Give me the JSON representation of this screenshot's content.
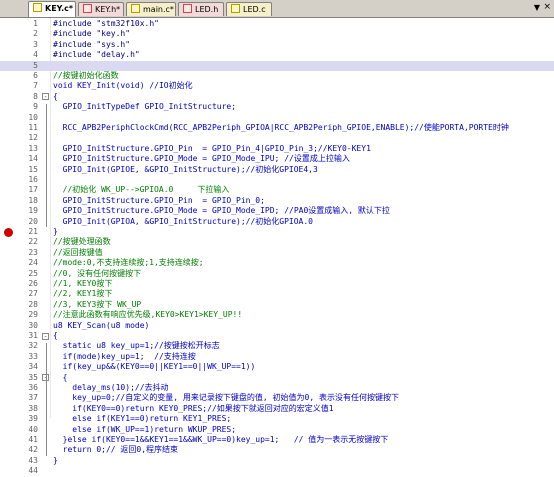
{
  "tabs": [
    {
      "label": "KEY.c*",
      "type": "c",
      "active": true
    },
    {
      "label": "KEY.h*",
      "type": "h",
      "active": false
    },
    {
      "label": "main.c*",
      "type": "c",
      "active": false
    },
    {
      "label": "LED.h",
      "type": "h",
      "active": false
    },
    {
      "label": "LED.c",
      "type": "c",
      "active": false
    }
  ],
  "tabbar": {
    "dropdown_glyph": "▼",
    "close_glyph": "×"
  },
  "editor": {
    "highlight_line": 5,
    "breakpoint_line": 21,
    "lines": [
      {
        "n": "1",
        "text": "#include \"stm32f10x.h\"",
        "style": "pp"
      },
      {
        "n": "2",
        "text": "#include \"key.h\"",
        "style": "pp"
      },
      {
        "n": "3",
        "text": "#include \"sys.h\"",
        "style": "pp"
      },
      {
        "n": "4",
        "text": "#include \"delay.h\"",
        "style": "pp"
      },
      {
        "n": "5",
        "text": "",
        "style": "code"
      },
      {
        "n": "6",
        "text": "//按键初始化函数",
        "style": "cm"
      },
      {
        "n": "7",
        "text": "void KEY_Init(void) //IO初始化",
        "style": "code"
      },
      {
        "n": "8",
        "text": "{",
        "style": "code",
        "fold": "-"
      },
      {
        "n": "9",
        "text": "  GPIO_InitTypeDef GPIO_InitStructure;",
        "style": "code"
      },
      {
        "n": "10",
        "text": "",
        "style": "code"
      },
      {
        "n": "11",
        "text": "  RCC_APB2PeriphClockCmd(RCC_APB2Periph_GPIOA|RCC_APB2Periph_GPIOE,ENABLE);//使能PORTA,PORTE时钟",
        "style": "code"
      },
      {
        "n": "12",
        "text": "",
        "style": "code"
      },
      {
        "n": "13",
        "text": "  GPIO_InitStructure.GPIO_Pin  = GPIO_Pin_4|GPIO_Pin_3;//KEY0-KEY1",
        "style": "code"
      },
      {
        "n": "14",
        "text": "  GPIO_InitStructure.GPIO_Mode = GPIO_Mode_IPU; //设置成上拉输入",
        "style": "code"
      },
      {
        "n": "15",
        "text": "  GPIO_Init(GPIOE, &GPIO_InitStructure);//初始化GPIOE4,3",
        "style": "code"
      },
      {
        "n": "16",
        "text": "",
        "style": "code"
      },
      {
        "n": "17",
        "text": "  //初始化 WK_UP-->GPIOA.0     下拉输入",
        "style": "cm"
      },
      {
        "n": "18",
        "text": "  GPIO_InitStructure.GPIO_Pin  = GPIO_Pin_0;",
        "style": "code"
      },
      {
        "n": "19",
        "text": "  GPIO_InitStructure.GPIO_Mode = GPIO_Mode_IPD; //PA0设置成输入, 默认下拉",
        "style": "code"
      },
      {
        "n": "20",
        "text": "  GPIO_Init(GPIOA, &GPIO_InitStructure);//初始化GPIOA.0",
        "style": "code"
      },
      {
        "n": "21",
        "text": "}",
        "style": "code"
      },
      {
        "n": "22",
        "text": "//按键处理函数",
        "style": "cm"
      },
      {
        "n": "23",
        "text": "//返回按键值",
        "style": "cm"
      },
      {
        "n": "24",
        "text": "//mode:0,不支持连续按;1,支持连续按;",
        "style": "cm"
      },
      {
        "n": "25",
        "text": "//0, 没有任何按键按下",
        "style": "cm"
      },
      {
        "n": "26",
        "text": "//1, KEY0按下",
        "style": "cm"
      },
      {
        "n": "27",
        "text": "//2, KEY1按下",
        "style": "cm"
      },
      {
        "n": "28",
        "text": "//3, KEY3按下 WK_UP",
        "style": "cm"
      },
      {
        "n": "29",
        "text": "//注意此函数有响应优先级,KEY0>KEY1>KEY_UP!!",
        "style": "cm"
      },
      {
        "n": "30",
        "text": "u8 KEY_Scan(u8 mode)",
        "style": "code"
      },
      {
        "n": "31",
        "text": "{",
        "style": "code",
        "fold": "-"
      },
      {
        "n": "32",
        "text": "  static u8 key_up=1;//按键按松开标志",
        "style": "code"
      },
      {
        "n": "33",
        "text": "  if(mode)key_up=1;  //支持连按",
        "style": "code"
      },
      {
        "n": "34",
        "text": "  if(key_up&&(KEY0==0||KEY1==0||WK_UP==1))",
        "style": "code"
      },
      {
        "n": "35",
        "text": "  {",
        "style": "code",
        "fold": "-"
      },
      {
        "n": "36",
        "text": "    delay_ms(10);//去抖动",
        "style": "code"
      },
      {
        "n": "37",
        "text": "    key_up=0;//自定义的变量, 用来记录按下键盘的值, 初始值为0, 表示没有任何按键按下",
        "style": "code"
      },
      {
        "n": "38",
        "text": "    if(KEY0==0)return KEY0_PRES;//如果按下就返回对应的宏定义值1",
        "style": "code"
      },
      {
        "n": "39",
        "text": "    else if(KEY1==0)return KEY1_PRES;",
        "style": "code"
      },
      {
        "n": "40",
        "text": "    else if(WK_UP==1)return WKUP_PRES;",
        "style": "code"
      },
      {
        "n": "41",
        "text": "  }else if(KEY0==1&&KEY1==1&&WK_UP==0)key_up=1;   // 值为一表示无按键按下",
        "style": "code"
      },
      {
        "n": "42",
        "text": "  return 0;// 返回0,程序结束",
        "style": "code"
      },
      {
        "n": "43",
        "text": "}",
        "style": "code"
      },
      {
        "n": "44",
        "text": "",
        "style": "code"
      }
    ]
  }
}
